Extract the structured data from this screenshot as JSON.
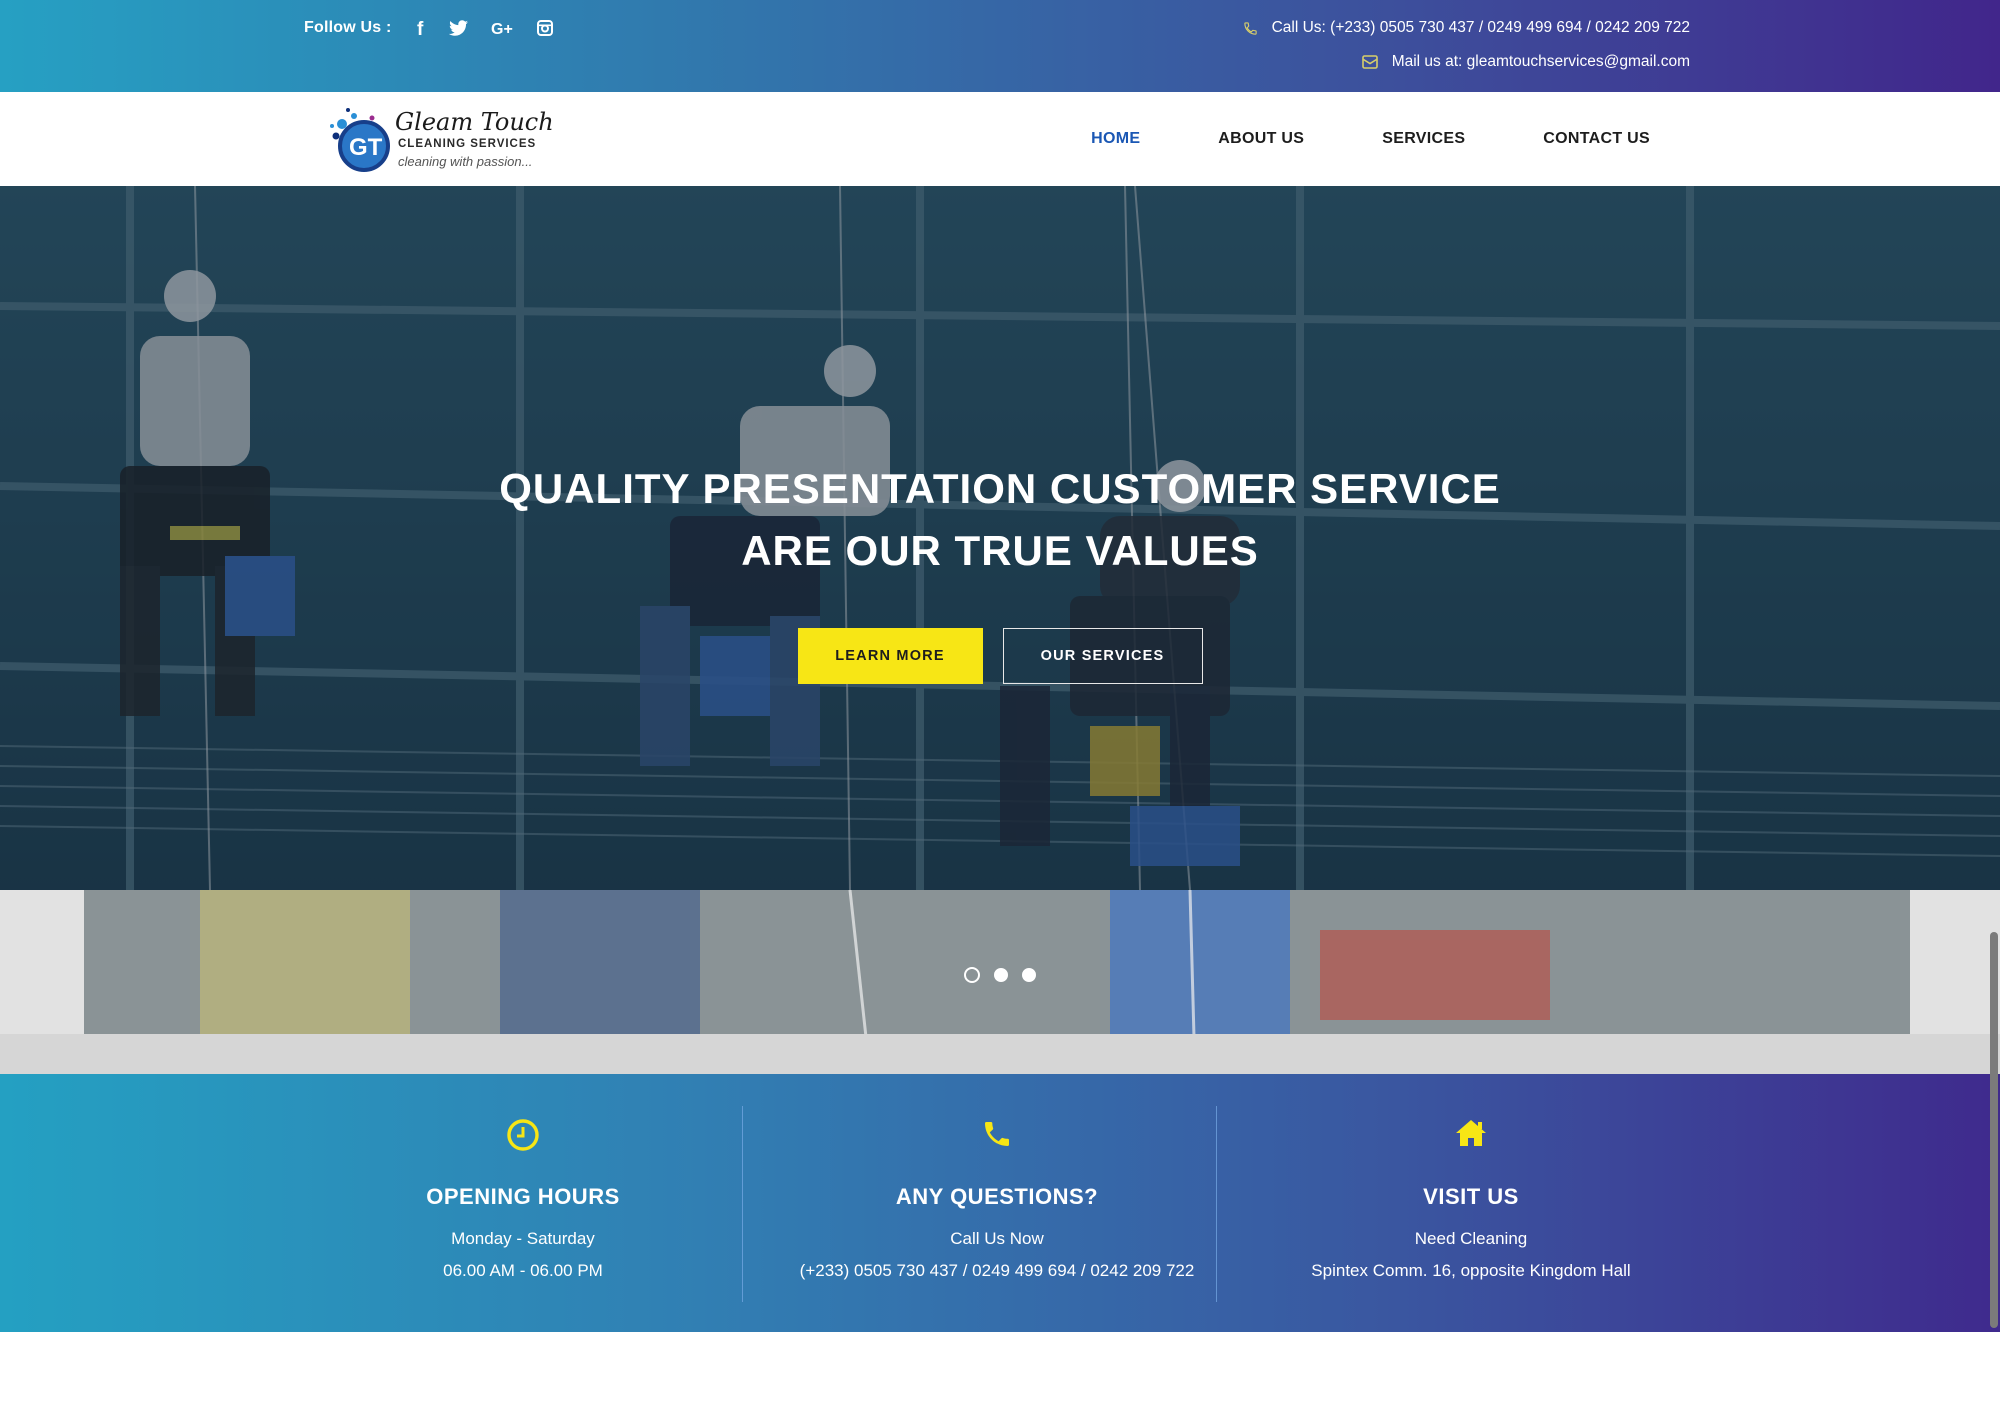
{
  "topbar": {
    "follow_label": "Follow Us :",
    "social": [
      "facebook-icon",
      "twitter-icon",
      "google-plus-icon",
      "instagram-icon"
    ],
    "social_text": {
      "facebook": "f",
      "google_plus": "G+"
    },
    "call_text": "Call Us: (+233) 0505 730 437 / 0249 499 694 / 0242 209 722",
    "mail_text": "Mail us at: gleamtouchservices@gmail.com"
  },
  "logo": {
    "name": "Gleam Touch",
    "subtitle": "CLEANING SERVICES",
    "tagline": "cleaning with passion...",
    "mark_letters": "GT"
  },
  "nav": {
    "items": [
      {
        "label": "HOME",
        "active": true
      },
      {
        "label": "ABOUT US",
        "active": false
      },
      {
        "label": "SERVICES",
        "active": false
      },
      {
        "label": "CONTACT US",
        "active": false
      }
    ]
  },
  "hero": {
    "title_line1": "QUALITY PRESENTATION CUSTOMER SERVICE",
    "title_line2": "ARE OUR TRUE VALUES",
    "learn_more": "LEARN MORE",
    "our_services": "OUR SERVICES",
    "slides_total": 3,
    "active_slide": 1
  },
  "info": [
    {
      "icon": "clock-icon",
      "title": "OPENING HOURS",
      "line1": "Monday - Saturday",
      "line2": "06.00 AM - 06.00 PM"
    },
    {
      "icon": "phone-icon",
      "title": "ANY QUESTIONS?",
      "line1": "Call Us Now",
      "line2": "(+233) 0505 730 437 / 0249 499 694 / 0242 209 722"
    },
    {
      "icon": "home-icon",
      "title": "VISIT US",
      "line1": "Need Cleaning",
      "line2": "Spintex Comm. 16, opposite Kingdom Hall"
    }
  ],
  "colors": {
    "accent_yellow": "#f7e615",
    "nav_active": "#1a57b4",
    "gradient_start": "#26a0c3",
    "gradient_end": "#41268b"
  }
}
